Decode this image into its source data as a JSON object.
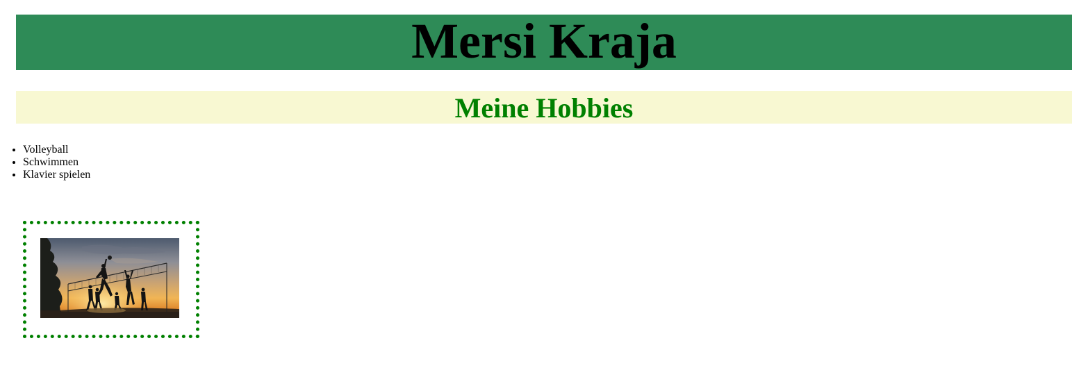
{
  "page": {
    "title": "Mersi Kraja",
    "section_heading": "Meine Hobbies"
  },
  "hobbies": [
    "Volleyball",
    "Schwimmen",
    "Klavier spielen"
  ],
  "image": {
    "subject": "volleyball-silhouette-sunset"
  },
  "colors": {
    "banner_bg": "#2e8b57",
    "subheader_bg": "#f8f8d2",
    "heading_green": "#008000",
    "frame_border": "#008000"
  }
}
